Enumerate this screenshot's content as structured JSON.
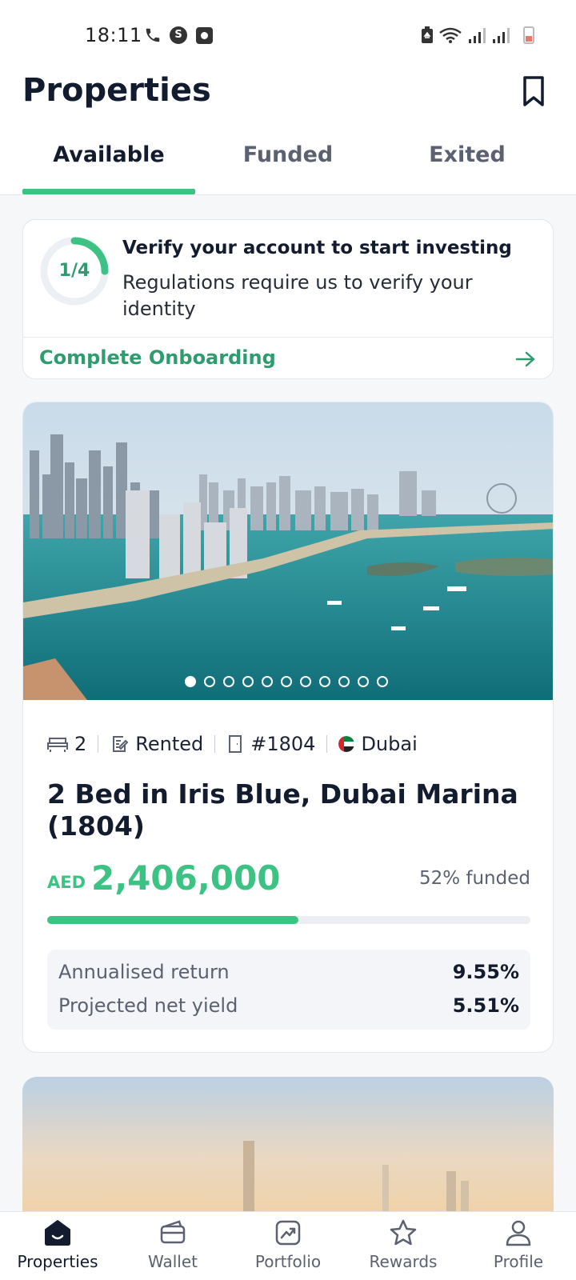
{
  "status_bar": {
    "time": "18:11"
  },
  "header": {
    "title": "Properties",
    "tabs": [
      {
        "label": "Available",
        "active": true
      },
      {
        "label": "Funded",
        "active": false
      },
      {
        "label": "Exited",
        "active": false
      }
    ]
  },
  "verify": {
    "progress_text": "1/4",
    "progress_fraction": 0.25,
    "title": "Verify your account to start investing",
    "description": "Regulations require us to verify your identity",
    "link_label": "Complete Onboarding"
  },
  "property": {
    "image_count": 11,
    "active_image": 1,
    "beds": "2",
    "status": "Rented",
    "unit": "#1804",
    "location": "Dubai",
    "title": "2 Bed in Iris Blue, Dubai Marina (1804)",
    "currency": "AED",
    "price": "2,406,000",
    "funded_text": "52% funded",
    "funded_percent": 52,
    "stats": [
      {
        "label": "Annualised return",
        "value": "9.55%"
      },
      {
        "label": "Projected net yield",
        "value": "5.51%"
      }
    ]
  },
  "bottom_nav": [
    {
      "label": "Properties",
      "icon": "home-icon",
      "active": true
    },
    {
      "label": "Wallet",
      "icon": "wallet-icon",
      "active": false
    },
    {
      "label": "Portfolio",
      "icon": "portfolio-chart-icon",
      "active": false
    },
    {
      "label": "Rewards",
      "icon": "star-icon",
      "active": false
    },
    {
      "label": "Profile",
      "icon": "person-icon",
      "active": false
    }
  ],
  "colors": {
    "accent": "#3cc383",
    "accent_dark": "#2f9c6f",
    "text": "#131c2e"
  }
}
